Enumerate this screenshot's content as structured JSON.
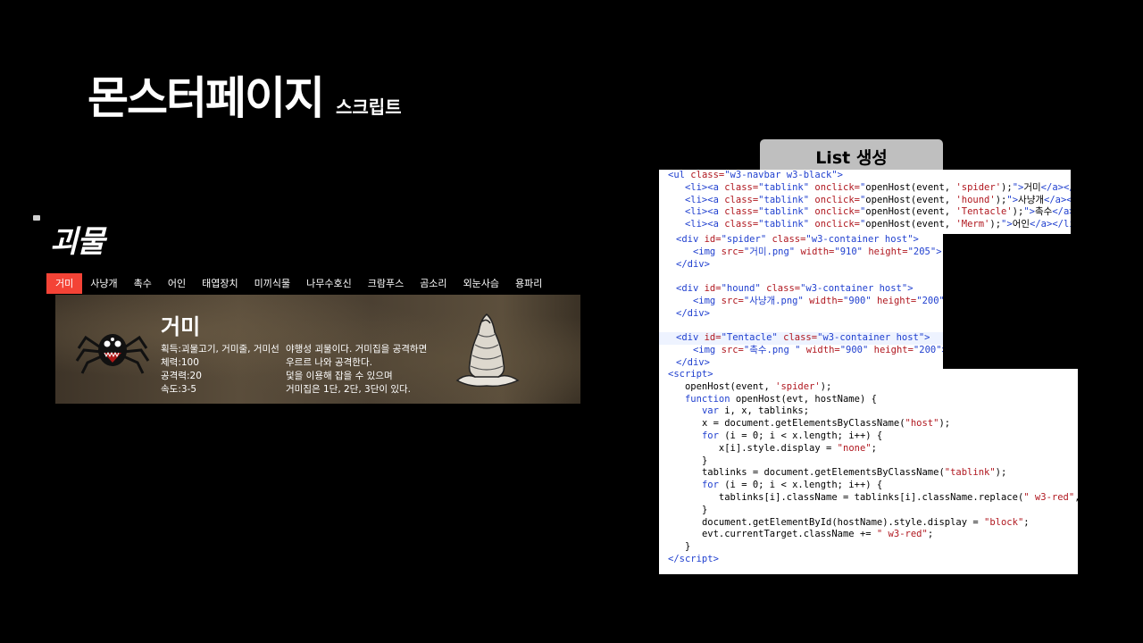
{
  "slide": {
    "title": "몬스터페이지",
    "subtitle": "스크립트"
  },
  "mock": {
    "logo": "괴물",
    "tabs": [
      {
        "label": "거미",
        "active": true
      },
      {
        "label": "사냥개",
        "active": false
      },
      {
        "label": "촉수",
        "active": false
      },
      {
        "label": "어인",
        "active": false
      },
      {
        "label": "태엽장치",
        "active": false
      },
      {
        "label": "미끼식물",
        "active": false
      },
      {
        "label": "나무수호신",
        "active": false
      },
      {
        "label": "크람푸스",
        "active": false
      },
      {
        "label": "곰소리",
        "active": false
      },
      {
        "label": "외눈사슴",
        "active": false
      },
      {
        "label": "용파리",
        "active": false
      }
    ],
    "active_color": "#f44336",
    "banner": {
      "name": "거미",
      "stats": [
        "획득:괴물고기, 거미줄, 거미선",
        "체력:100",
        "공격력:20",
        "속도:3-5"
      ],
      "desc": [
        "야행성 괴물이다. 거미집을 공격하면",
        "우르르 나와 공격한다.",
        "덫을 이용해 잡을 수 있으며",
        "거미집은 1단, 2단, 3단이 있다."
      ]
    }
  },
  "badge": {
    "label": "List 생성"
  },
  "code": {
    "ul_lines": [
      {
        "indent": "",
        "parts": [
          [
            "t",
            "<ul "
          ],
          [
            "a",
            "class="
          ],
          [
            "s",
            "\"w3-navbar w3-black\""
          ],
          [
            "t",
            ">"
          ]
        ]
      },
      {
        "indent": "   ",
        "parts": [
          [
            "t",
            "<li><a "
          ],
          [
            "a",
            "class="
          ],
          [
            "s",
            "\"tablink\" "
          ],
          [
            "a",
            "onclick="
          ],
          [
            "s",
            "\""
          ],
          [
            "",
            "openHost(event, "
          ],
          [
            "a",
            "'spider'"
          ],
          [
            "",
            ");"
          ],
          [
            "s",
            "\">"
          ],
          [
            "",
            "거미"
          ],
          [
            "t",
            "</a></li>"
          ]
        ]
      },
      {
        "indent": "   ",
        "parts": [
          [
            "t",
            "<li><a "
          ],
          [
            "a",
            "class="
          ],
          [
            "s",
            "\"tablink\" "
          ],
          [
            "a",
            "onclick="
          ],
          [
            "s",
            "\""
          ],
          [
            "",
            "openHost(event, "
          ],
          [
            "a",
            "'hound'"
          ],
          [
            "",
            ");"
          ],
          [
            "s",
            "\">"
          ],
          [
            "",
            "사냥개"
          ],
          [
            "t",
            "</a></li>"
          ]
        ]
      },
      {
        "indent": "   ",
        "parts": [
          [
            "t",
            "<li><a "
          ],
          [
            "a",
            "class="
          ],
          [
            "s",
            "\"tablink\" "
          ],
          [
            "a",
            "onclick="
          ],
          [
            "s",
            "\""
          ],
          [
            "",
            "openHost(event, "
          ],
          [
            "a",
            "'Tentacle'"
          ],
          [
            "",
            ");"
          ],
          [
            "s",
            "\">"
          ],
          [
            "",
            "촉수"
          ],
          [
            "t",
            "</a></li>"
          ]
        ]
      },
      {
        "indent": "   ",
        "parts": [
          [
            "t",
            "<li><a "
          ],
          [
            "a",
            "class="
          ],
          [
            "s",
            "\"tablink\" "
          ],
          [
            "a",
            "onclick="
          ],
          [
            "s",
            "\""
          ],
          [
            "",
            "openHost(event, "
          ],
          [
            "a",
            "'Merm'"
          ],
          [
            "",
            ");"
          ],
          [
            "s",
            "\">"
          ],
          [
            "",
            "어인"
          ],
          [
            "t",
            "</a></li>"
          ]
        ]
      }
    ],
    "div_lines": [
      {
        "indent": "",
        "parts": [
          [
            "t",
            "<div "
          ],
          [
            "a",
            "id="
          ],
          [
            "s",
            "\"spider\" "
          ],
          [
            "a",
            "class="
          ],
          [
            "s",
            "\"w3-container host\""
          ],
          [
            "t",
            ">"
          ]
        ]
      },
      {
        "indent": "   ",
        "parts": [
          [
            "t",
            "<img "
          ],
          [
            "a",
            "src="
          ],
          [
            "s",
            "\"거미.png\" "
          ],
          [
            "a",
            "width="
          ],
          [
            "s",
            "\"910\" "
          ],
          [
            "a",
            "height="
          ],
          [
            "s",
            "\"205\""
          ],
          [
            "t",
            ">"
          ]
        ]
      },
      {
        "indent": "",
        "parts": [
          [
            "t",
            "</div>"
          ]
        ]
      },
      {
        "indent": "",
        "parts": []
      },
      {
        "indent": "",
        "parts": [
          [
            "t",
            "<div "
          ],
          [
            "a",
            "id="
          ],
          [
            "s",
            "\"hound\" "
          ],
          [
            "a",
            "class="
          ],
          [
            "s",
            "\"w3-container host\""
          ],
          [
            "t",
            ">"
          ]
        ]
      },
      {
        "indent": "   ",
        "parts": [
          [
            "t",
            "<img "
          ],
          [
            "a",
            "src="
          ],
          [
            "s",
            "\"사냥개.png\" "
          ],
          [
            "a",
            "width="
          ],
          [
            "s",
            "\"900\" "
          ],
          [
            "a",
            "height="
          ],
          [
            "s",
            "\"200\""
          ],
          [
            "t",
            ">"
          ]
        ]
      },
      {
        "indent": "",
        "parts": [
          [
            "t",
            "</div>"
          ]
        ]
      },
      {
        "indent": "",
        "parts": []
      },
      {
        "indent": "",
        "parts": [
          [
            "t",
            "<div "
          ],
          [
            "a",
            "id="
          ],
          [
            "s",
            "\"Tentacle\" "
          ],
          [
            "a",
            "class="
          ],
          [
            "s",
            "\"w3-container host\""
          ],
          [
            "t",
            ">"
          ]
        ]
      },
      {
        "indent": "   ",
        "parts": [
          [
            "t",
            "<img "
          ],
          [
            "a",
            "src="
          ],
          [
            "s",
            "\"촉수.png \" "
          ],
          [
            "a",
            "width="
          ],
          [
            "s",
            "\"900\" "
          ],
          [
            "a",
            "height="
          ],
          [
            "s",
            "\"200\""
          ],
          [
            "t",
            ">"
          ]
        ]
      },
      {
        "indent": "",
        "parts": [
          [
            "t",
            "</div>"
          ]
        ]
      }
    ],
    "script_lines": [
      {
        "indent": "",
        "parts": [
          [
            "t",
            "<script>"
          ]
        ]
      },
      {
        "indent": "   ",
        "parts": [
          [
            "",
            "openHost(event, "
          ],
          [
            "a",
            "'spider'"
          ],
          [
            "",
            ");"
          ]
        ]
      },
      {
        "indent": "   ",
        "parts": [
          [
            "k",
            "function "
          ],
          [
            "",
            "openHost(evt, hostName) {"
          ]
        ]
      },
      {
        "indent": "      ",
        "parts": [
          [
            "k",
            "var "
          ],
          [
            "",
            "i, x, tablinks;"
          ]
        ]
      },
      {
        "indent": "      ",
        "parts": [
          [
            "",
            "x = document.getElementsByClassName("
          ],
          [
            "a",
            "\"host\""
          ],
          [
            "",
            ");"
          ]
        ]
      },
      {
        "indent": "      ",
        "parts": [
          [
            "k",
            "for "
          ],
          [
            "",
            "(i = 0; i < x.length; i++) {"
          ]
        ]
      },
      {
        "indent": "         ",
        "parts": [
          [
            "",
            "x[i].style.display = "
          ],
          [
            "a",
            "\"none\""
          ],
          [
            "",
            ";"
          ]
        ]
      },
      {
        "indent": "      ",
        "parts": [
          [
            "",
            "}"
          ]
        ]
      },
      {
        "indent": "      ",
        "parts": [
          [
            "",
            "tablinks = document.getElementsByClassName("
          ],
          [
            "a",
            "\"tablink\""
          ],
          [
            "",
            ");"
          ]
        ]
      },
      {
        "indent": "      ",
        "parts": [
          [
            "k",
            "for "
          ],
          [
            "",
            "(i = 0; i < x.length; i++) {"
          ]
        ]
      },
      {
        "indent": "         ",
        "parts": [
          [
            "",
            "tablinks[i].className = tablinks[i].className.replace("
          ],
          [
            "a",
            "\" w3-red\""
          ],
          [
            "",
            ", "
          ],
          [
            "a",
            "\"\""
          ],
          [
            "",
            ");"
          ]
        ]
      },
      {
        "indent": "      ",
        "parts": [
          [
            "",
            "}"
          ]
        ]
      },
      {
        "indent": "      ",
        "parts": [
          [
            "",
            "document.getElementById(hostName).style.display = "
          ],
          [
            "a",
            "\"block\""
          ],
          [
            "",
            ";"
          ]
        ]
      },
      {
        "indent": "      ",
        "parts": [
          [
            "",
            "evt.currentTarget.className += "
          ],
          [
            "a",
            "\" w3-red\""
          ],
          [
            "",
            ";"
          ]
        ]
      },
      {
        "indent": "   ",
        "parts": [
          [
            "",
            "}"
          ]
        ]
      },
      {
        "indent": "",
        "parts": [
          [
            "t",
            "</scr"
          ],
          [
            "t",
            "ipt>"
          ]
        ]
      }
    ]
  }
}
